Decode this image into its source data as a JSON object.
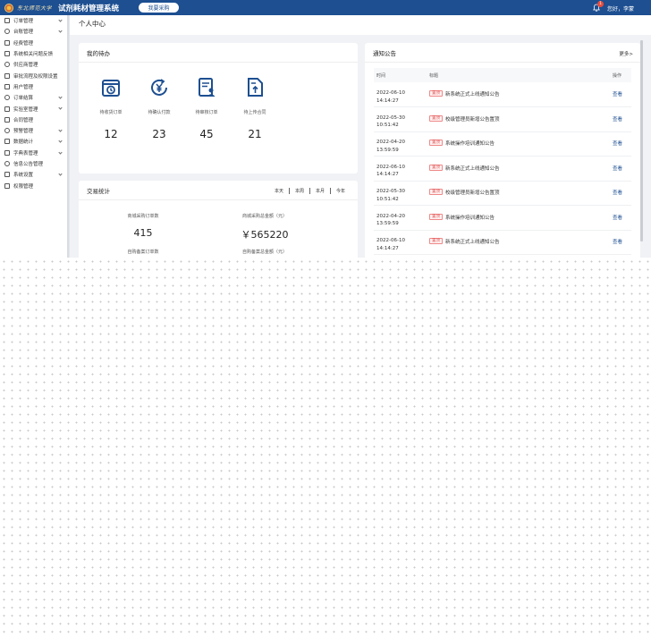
{
  "header": {
    "logo_text": "东北师范大学",
    "system_title": "试剂耗材管理系统",
    "buy_button": "我要采购",
    "notification_count": "1",
    "greeting": "您好，李蒙"
  },
  "sidebar": {
    "items": [
      {
        "label": "订单管理",
        "icon": "order-icon",
        "expandable": true
      },
      {
        "label": "台账管理",
        "icon": "ledger-icon",
        "expandable": true
      },
      {
        "label": "经费管理",
        "icon": "funds-icon",
        "expandable": false
      },
      {
        "label": "系统相关问题反馈",
        "icon": "feedback-icon",
        "expandable": false
      },
      {
        "label": "供应商管理",
        "icon": "supplier-icon",
        "expandable": false
      },
      {
        "label": "审批流程及权限设置",
        "icon": "approval-icon",
        "expandable": false
      },
      {
        "label": "用户管理",
        "icon": "user-icon",
        "expandable": false
      },
      {
        "label": "订单结算",
        "icon": "settlement-icon",
        "expandable": true
      },
      {
        "label": "实验室管理",
        "icon": "lab-icon",
        "expandable": true
      },
      {
        "label": "合同管理",
        "icon": "contract-icon",
        "expandable": false
      },
      {
        "label": "预警管理",
        "icon": "warning-icon",
        "expandable": true
      },
      {
        "label": "数据统计",
        "icon": "stats-icon",
        "expandable": true
      },
      {
        "label": "字典表管理",
        "icon": "dictionary-icon",
        "expandable": true
      },
      {
        "label": "信息公告管理",
        "icon": "announcement-icon",
        "expandable": false
      },
      {
        "label": "系统设置",
        "icon": "settings-icon",
        "expandable": true
      },
      {
        "label": "权限管理",
        "icon": "permission-icon",
        "expandable": false
      }
    ]
  },
  "page": {
    "title": "个人中心"
  },
  "todo": {
    "title": "我的待办",
    "items": [
      {
        "label": "待收货订单",
        "count": "12",
        "icon": "clock-box-icon"
      },
      {
        "label": "待确认付款",
        "count": "23",
        "icon": "yuan-refresh-icon"
      },
      {
        "label": "待审核订单",
        "count": "45",
        "icon": "document-user-icon"
      },
      {
        "label": "待上传合同",
        "count": "21",
        "icon": "upload-document-icon"
      }
    ]
  },
  "stats": {
    "title": "交易统计",
    "tabs": [
      "本天",
      "本周",
      "本月",
      "今年"
    ],
    "items": [
      {
        "label": "商城采购订单数",
        "value": "415"
      },
      {
        "label": "商城采购总金额（元）",
        "value": "￥565220"
      },
      {
        "label": "自购备案订单数",
        "value": ""
      },
      {
        "label": "自购备案总金额（元）",
        "value": ""
      }
    ]
  },
  "notices": {
    "title": "通知公告",
    "more": "更多>",
    "columns": [
      "时间",
      "标题",
      "操作"
    ],
    "rows": [
      {
        "date": "2022-06-10",
        "time": "14:14:27",
        "tag": "置顶",
        "title": "新系统正式上线通知公告",
        "action": "查看"
      },
      {
        "date": "2022-05-30",
        "time": "10:51:42",
        "tag": "置顶",
        "title": "校级管理员新增公告置顶",
        "action": "查看"
      },
      {
        "date": "2022-04-20",
        "time": "13:59:59",
        "tag": "置顶",
        "title": "系统操作培训通知公告",
        "action": "查看"
      },
      {
        "date": "2022-06-10",
        "time": "14:14:27",
        "tag": "置顶",
        "title": "新系统正式上线通知公告",
        "action": "查看"
      },
      {
        "date": "2022-05-30",
        "time": "10:51:42",
        "tag": "置顶",
        "title": "校级管理员新增公告置顶",
        "action": "查看"
      },
      {
        "date": "2022-04-20",
        "time": "13:59:59",
        "tag": "置顶",
        "title": "系统操作培训通知公告",
        "action": "查看"
      },
      {
        "date": "2022-06-10",
        "time": "14:14:27",
        "tag": "置顶",
        "title": "新系统正式上线通知公告",
        "action": "查看"
      }
    ]
  },
  "colors": {
    "primary": "#1d4f91",
    "tag_red": "#e05050",
    "background": "#f0f2f5"
  }
}
